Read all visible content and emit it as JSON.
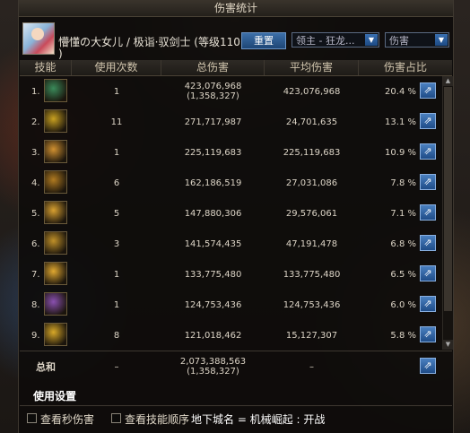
{
  "window": {
    "title": "伤害统计"
  },
  "header": {
    "name_line1": "懵懂の大女儿 / 极诣·驭剑士 (等级110",
    "name_line2": ")",
    "reset_label": "重置",
    "target_select": "领主 - 狂龙...",
    "type_select": "伤害"
  },
  "columns": [
    "技能",
    "使用次数",
    "总伤害",
    "平均伤害",
    "伤害占比"
  ],
  "rows": [
    {
      "rank": "1.",
      "uses": "1",
      "total": "423,076,968",
      "total_sub": "(1,358,327)",
      "avg": "423,076,968",
      "pct": "20.4 %",
      "color": "#3a8a5a"
    },
    {
      "rank": "2.",
      "uses": "11",
      "total": "271,717,987",
      "total_sub": "",
      "avg": "24,701,635",
      "pct": "13.1 %",
      "color": "#c8a020"
    },
    {
      "rank": "3.",
      "uses": "1",
      "total": "225,119,683",
      "total_sub": "",
      "avg": "225,119,683",
      "pct": "10.9 %",
      "color": "#d09030"
    },
    {
      "rank": "4.",
      "uses": "6",
      "total": "162,186,519",
      "total_sub": "",
      "avg": "27,031,086",
      "pct": "7.8 %",
      "color": "#b07a20"
    },
    {
      "rank": "5.",
      "uses": "5",
      "total": "147,880,306",
      "total_sub": "",
      "avg": "29,576,061",
      "pct": "7.1 %",
      "color": "#d8a030"
    },
    {
      "rank": "6.",
      "uses": "3",
      "total": "141,574,435",
      "total_sub": "",
      "avg": "47,191,478",
      "pct": "6.8 %",
      "color": "#c09028"
    },
    {
      "rank": "7.",
      "uses": "1",
      "total": "133,775,480",
      "total_sub": "",
      "avg": "133,775,480",
      "pct": "6.5 %",
      "color": "#e0a830"
    },
    {
      "rank": "8.",
      "uses": "1",
      "total": "124,753,436",
      "total_sub": "",
      "avg": "124,753,436",
      "pct": "6.0 %",
      "color": "#8a50b0"
    },
    {
      "rank": "9.",
      "uses": "8",
      "total": "121,018,462",
      "total_sub": "",
      "avg": "15,127,307",
      "pct": "5.8 %",
      "color": "#d8a828"
    }
  ],
  "total": {
    "label": "总和",
    "uses": "–",
    "total": "2,073,388,563",
    "total_sub": "(1,358,327)",
    "avg": "–"
  },
  "settings_tab": "使用设置",
  "footer": {
    "check1": "查看秒伤害",
    "check2": "查看技能顺序",
    "dungeon": "地下城名 = 机械崛起 : 开战"
  }
}
